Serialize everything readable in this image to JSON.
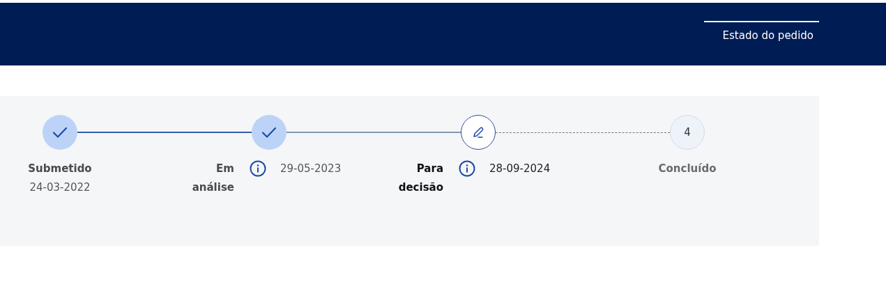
{
  "header": {
    "tabs": [
      {
        "label": "Estado do pedido",
        "selected": true
      }
    ]
  },
  "steps": [
    {
      "kind": "done",
      "label": "Submetido",
      "date": "24-03-2022",
      "info": false
    },
    {
      "kind": "done",
      "label": "Em análise",
      "date": "29-05-2023",
      "info": true
    },
    {
      "kind": "current",
      "label": "Para decisão",
      "date": "28-09-2024",
      "info": true
    },
    {
      "kind": "pending",
      "label": "Concluído",
      "number": "4",
      "info": false
    }
  ],
  "connectors": [
    {
      "kind": "active"
    },
    {
      "kind": "solid"
    },
    {
      "kind": "dotted"
    }
  ]
}
